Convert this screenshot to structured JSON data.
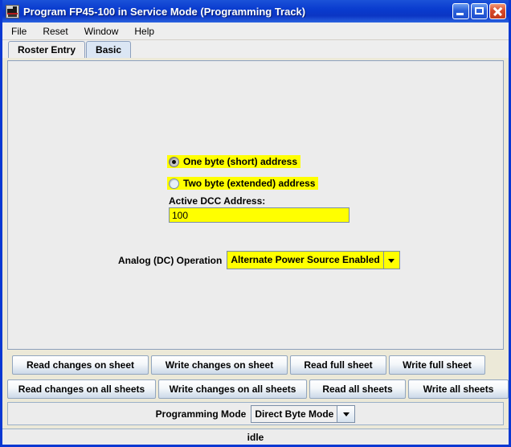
{
  "window": {
    "title": "Program FP45-100 in Service Mode (Programming Track)",
    "icon": "locomotive-icon",
    "controls": {
      "minimize": "minimize-icon",
      "maximize": "maximize-icon",
      "close": "close-icon"
    }
  },
  "menubar": {
    "items": [
      {
        "label": "File"
      },
      {
        "label": "Reset"
      },
      {
        "label": "Window"
      },
      {
        "label": "Help"
      }
    ]
  },
  "tabs": [
    {
      "label": "Roster Entry",
      "active": false
    },
    {
      "label": "Basic",
      "active": true
    }
  ],
  "form": {
    "address_options": [
      {
        "label": "One byte (short) address",
        "selected": true
      },
      {
        "label": "Two byte (extended) address",
        "selected": false
      }
    ],
    "dcc_address": {
      "label": "Active DCC Address:",
      "value": "100"
    },
    "analog": {
      "label": "Analog (DC) Operation",
      "value": "Alternate Power Source Enabled"
    }
  },
  "buttons": {
    "sheet_row": [
      {
        "label": "Read changes on sheet"
      },
      {
        "label": "Write changes on sheet"
      },
      {
        "label": "Read full sheet"
      },
      {
        "label": "Write full sheet"
      }
    ],
    "all_sheets_row": [
      {
        "label": "Read changes on all sheets"
      },
      {
        "label": "Write changes on all sheets"
      },
      {
        "label": "Read all sheets"
      },
      {
        "label": "Write all sheets"
      }
    ]
  },
  "programming_mode": {
    "label": "Programming Mode",
    "value": "Direct Byte Mode"
  },
  "status": {
    "text": "idle"
  },
  "colors": {
    "highlight": "#ffff00",
    "titlebar": "#0a3ccf",
    "frame": "#0a38d2",
    "panel": "#ececec",
    "tab_active": "#dbe6f4"
  }
}
